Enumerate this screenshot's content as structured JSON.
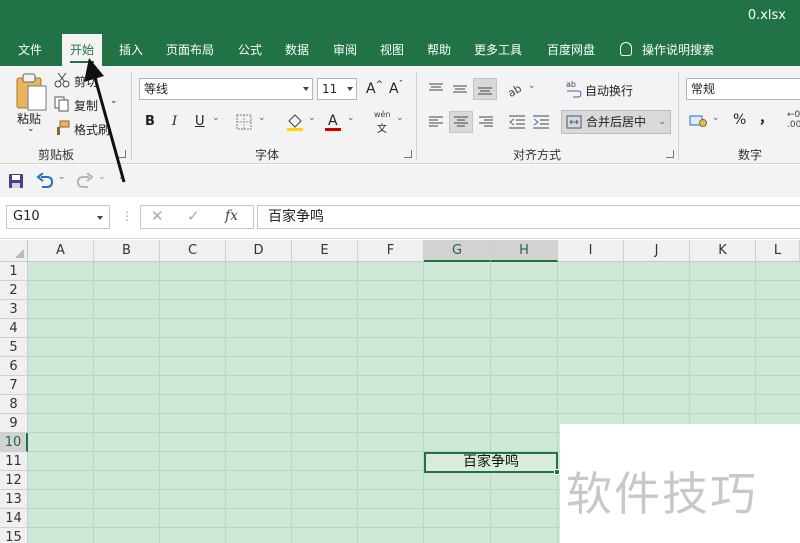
{
  "window": {
    "filename": "0.xlsx"
  },
  "tabs": [
    {
      "label": "文件",
      "active": false
    },
    {
      "label": "开始",
      "active": true
    },
    {
      "label": "插入",
      "active": false
    },
    {
      "label": "页面布局",
      "active": false
    },
    {
      "label": "公式",
      "active": false
    },
    {
      "label": "数据",
      "active": false
    },
    {
      "label": "审阅",
      "active": false
    },
    {
      "label": "视图",
      "active": false
    },
    {
      "label": "帮助",
      "active": false
    },
    {
      "label": "更多工具",
      "active": false
    },
    {
      "label": "百度网盘",
      "active": false
    }
  ],
  "tell_me": "操作说明搜索",
  "ribbon": {
    "clipboard": {
      "paste": "粘贴",
      "cut": "剪切",
      "copy": "复制",
      "format_painter": "格式刷",
      "label": "剪贴板"
    },
    "font": {
      "font_name": "等线",
      "font_size": "11",
      "bold": "B",
      "italic": "I",
      "underline": "U",
      "label": "字体",
      "pinyin": "文"
    },
    "alignment": {
      "wrap_text": "自动换行",
      "merge_center": "合并后居中",
      "label": "对齐方式"
    },
    "number": {
      "format": "常规",
      "percent": "%",
      "comma": "，",
      "label": "数字"
    }
  },
  "formula_bar": {
    "name_box": "G10",
    "fx": "fx",
    "content": "百家争鸣"
  },
  "grid": {
    "columns": [
      "A",
      "B",
      "C",
      "D",
      "E",
      "F",
      "G",
      "H",
      "I",
      "J",
      "K",
      "L"
    ],
    "selected_columns": [
      "G",
      "H"
    ],
    "rows": [
      "1",
      "2",
      "3",
      "4",
      "5",
      "6",
      "7",
      "8",
      "9",
      "10",
      "11",
      "12",
      "13",
      "14",
      "15"
    ],
    "selected_row": "10",
    "cell_text": "百家争鸣"
  },
  "colors": {
    "brand": "#217346",
    "sheet_background": "#cfe7d6"
  },
  "watermark": "软件技巧"
}
